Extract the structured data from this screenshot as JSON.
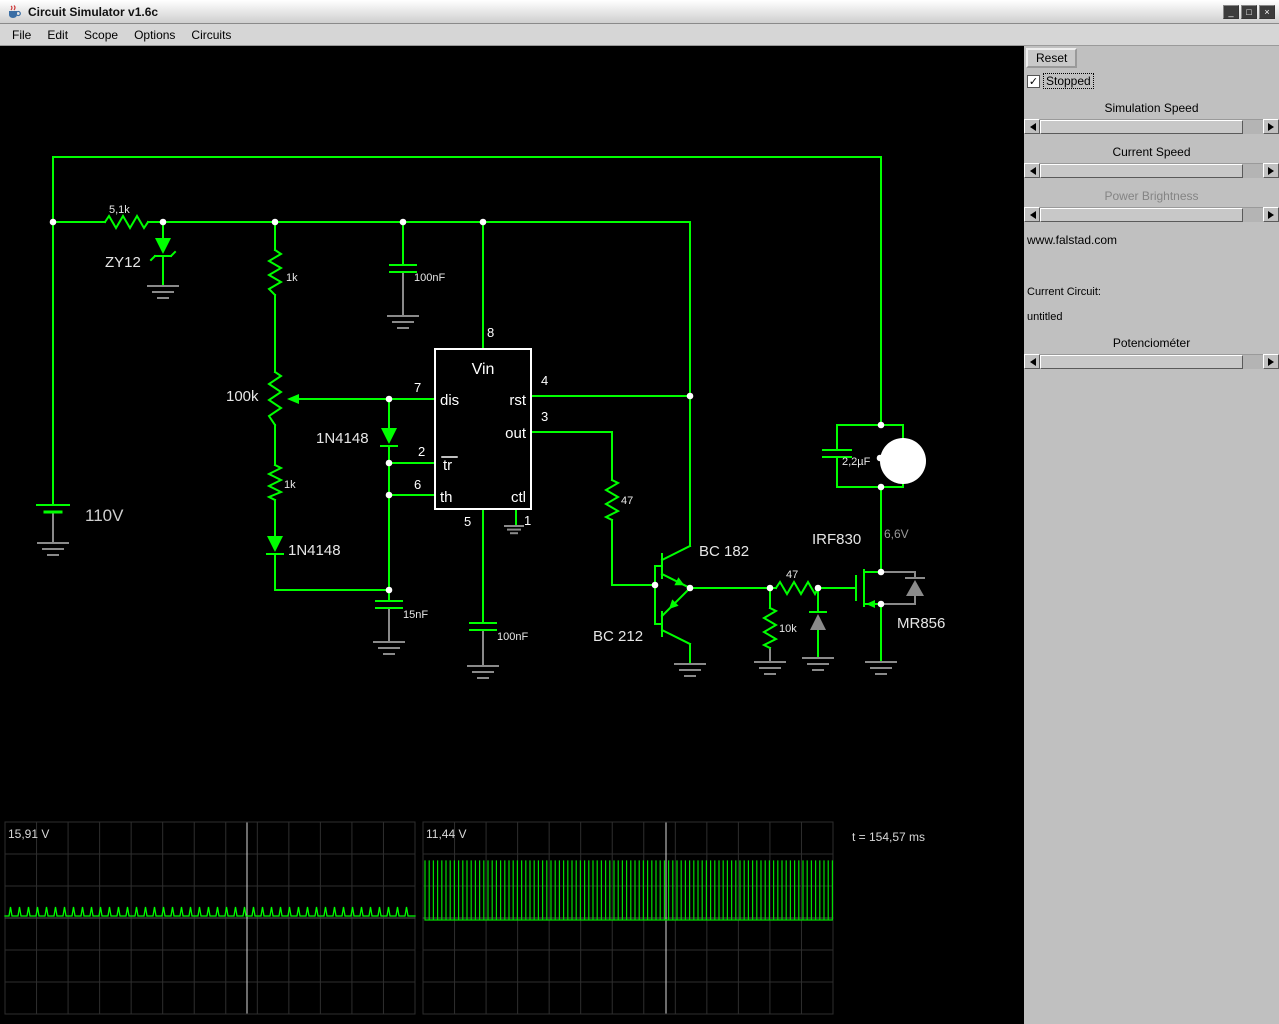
{
  "window": {
    "title": "Circuit Simulator v1.6c",
    "controls": {
      "minimize": "_",
      "maximize": "□",
      "close": "×"
    }
  },
  "menu": {
    "items": [
      "File",
      "Edit",
      "Scope",
      "Options",
      "Circuits"
    ]
  },
  "sidebar": {
    "reset_label": "Reset",
    "stopped_label": "Stopped",
    "stopped_checked": true,
    "check_glyph": "✓",
    "labels": {
      "simulation_speed": "Simulation Speed",
      "current_speed": "Current Speed",
      "power_brightness": "Power Brightness",
      "potentiometer": "Potenciométer"
    },
    "website": "www.falstad.com",
    "current_circuit_label": "Current Circuit:",
    "circuit_name": "untitled"
  },
  "circuit": {
    "labels": {
      "source_voltage": "110V",
      "r_input": "5,1k",
      "zener_input": "ZY12",
      "r_top": "1k",
      "c_supply": "100nF",
      "potentiometer": "100k",
      "d_charge": "1N4148",
      "r_lower": "1k",
      "d_discharge": "1N4148",
      "c_timing": "15nF",
      "c_control": "100nF",
      "r_out": "47",
      "npn": "BC 182",
      "pnp": "BC 212",
      "r_gate": "47",
      "r_pulldown": "10k",
      "mosfet": "IRF830",
      "c_snubber": "2,2µF",
      "v_node": "6,6V",
      "d_flyback": "MR856"
    },
    "chip": {
      "vin": "Vin",
      "dis": "dis",
      "rst": "rst",
      "out": "out",
      "tr": "tr",
      "th": "th",
      "ctl": "ctl",
      "p1": "1",
      "p2": "2",
      "p3": "3",
      "p4": "4",
      "p5": "5",
      "p6": "6",
      "p7": "7",
      "p8": "8"
    }
  },
  "scopes": {
    "left_label": "15,91 V",
    "right_label": "11,44 V",
    "time_label": "t = 154,57 ms"
  }
}
